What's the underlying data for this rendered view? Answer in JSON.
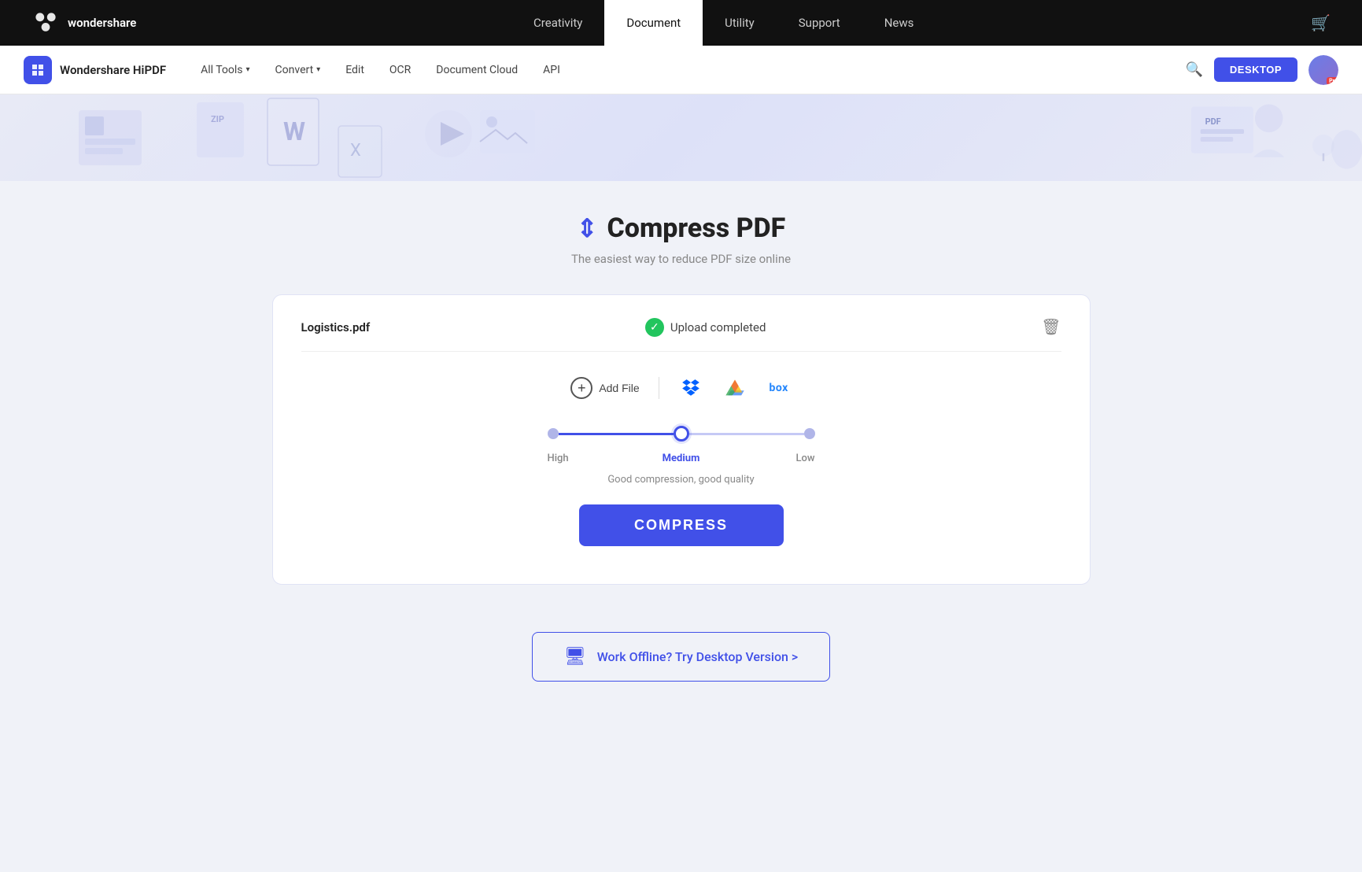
{
  "topNav": {
    "logoText": "wondershare",
    "links": [
      {
        "label": "Creativity",
        "active": false
      },
      {
        "label": "Document",
        "active": true
      },
      {
        "label": "Utility",
        "active": false
      },
      {
        "label": "Support",
        "active": false
      },
      {
        "label": "News",
        "active": false
      }
    ]
  },
  "secNav": {
    "brandName": "Wondershare HiPDF",
    "links": [
      {
        "label": "All Tools",
        "hasChevron": true
      },
      {
        "label": "Convert",
        "hasChevron": true
      },
      {
        "label": "Edit",
        "hasChevron": false
      },
      {
        "label": "OCR",
        "hasChevron": false
      },
      {
        "label": "Document Cloud",
        "hasChevron": false
      },
      {
        "label": "API",
        "hasChevron": false
      }
    ],
    "desktopBtn": "DESKTOP"
  },
  "page": {
    "title": "Compress PDF",
    "subtitle": "The easiest way to reduce PDF size online"
  },
  "uploadCard": {
    "fileName": "Logistics.pdf",
    "uploadStatus": "Upload completed",
    "addFileLabel": "Add File",
    "compressionLevels": [
      {
        "label": "High",
        "active": false
      },
      {
        "label": "Medium",
        "active": true
      },
      {
        "label": "Low",
        "active": false
      }
    ],
    "compressionDesc": "Good compression, good quality",
    "compressBtn": "COMPRESS"
  },
  "offlineBanner": {
    "text": "Work Offline? Try Desktop Version >"
  }
}
